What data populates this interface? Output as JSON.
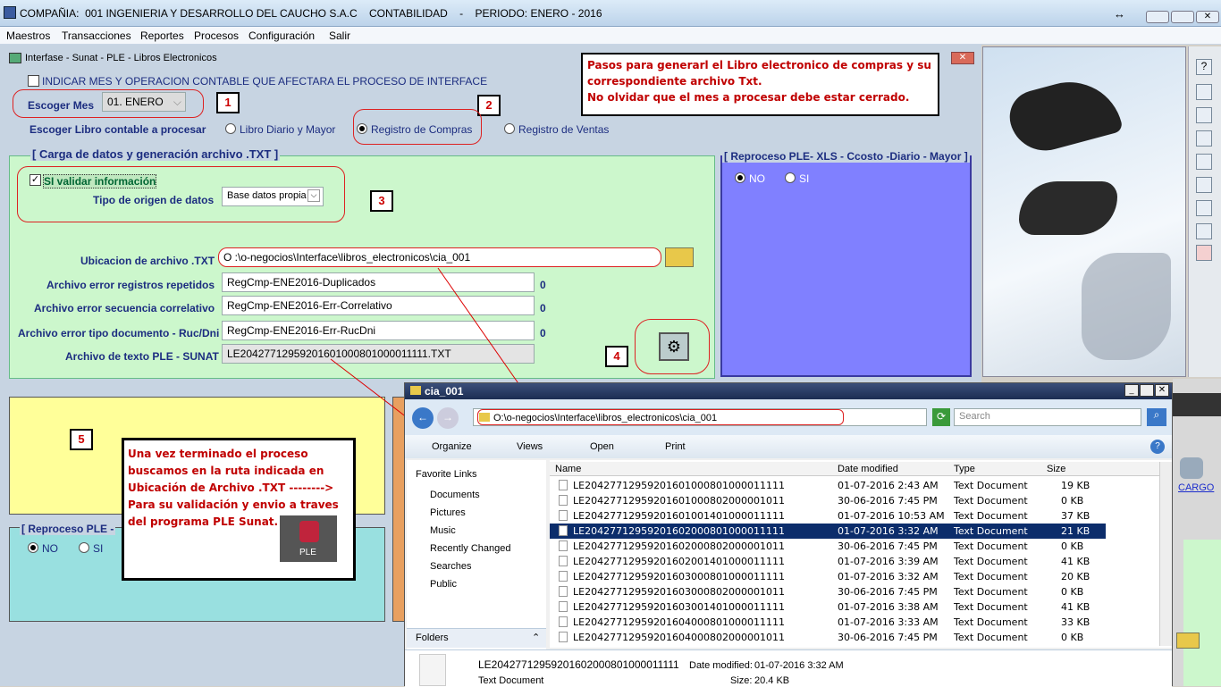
{
  "window": {
    "title": "COMPAÑIA:  001 INGENIERIA Y DESARROLLO DEL CAUCHO S.A.C    CONTABILIDAD    -    PERIODO: ENERO - 2016"
  },
  "menu": [
    "Maestros",
    "Transacciones",
    "Reportes",
    "Procesos",
    "Configuración",
    "Salir"
  ],
  "form": {
    "title": "Interfase - Sunat - PLE - Libros Electronicos",
    "indicator_label": "INDICAR MES Y OPERACION CONTABLE QUE AFECTARA EL PROCESO DE INTERFACE",
    "month_label": "Escoger Mes",
    "month_value": "01. ENERO",
    "book_label": "Escoger Libro contable a procesar",
    "books": [
      "Libro Diario y Mayor",
      "Registro de Compras",
      "Registro de Ventas"
    ],
    "carga_title": "[ Carga de datos y generación archivo  .TXT ]",
    "validate_label": "SI validar información",
    "origin_label": "Tipo de origen de datos",
    "origin_value": "Base datos propia",
    "location_label": "Ubicacion de archivo .TXT",
    "location_value": "O :\\o-negocios\\Interface\\libros_electronicos\\cia_001",
    "err_dup_label": "Archivo error registros repetidos",
    "err_dup_value": "RegCmp-ENE2016-Duplicados",
    "err_dup_count": "0",
    "err_seq_label": "Archivo error secuencia correlativo",
    "err_seq_value": "RegCmp-ENE2016-Err-Correlativo",
    "err_seq_count": "0",
    "err_ruc_label": "Archivo error tipo documento - Ruc/Dni",
    "err_ruc_value": "RegCmp-ENE2016-Err-RucDni",
    "err_ruc_count": "0",
    "txt_label": "Archivo de texto PLE - SUNAT",
    "txt_value": "LE20427712959201601000801000011111.TXT",
    "reproc_title": "[ Reproceso PLE- XLS - Ccosto -Diario - Mayor ]",
    "reproc_options": [
      "NO",
      "SI"
    ],
    "reproc2_title": "[ Reproceso PLE - ",
    "reproc2_options": [
      "NO",
      "SI"
    ],
    "steps": [
      "1",
      "2",
      "3",
      "4",
      "5"
    ]
  },
  "note_top": [
    "Pasos para generarl el Libro electronico de compras y su",
    "correspondiente archivo Txt.",
    "No olvidar que el mes a procesar debe estar cerrado."
  ],
  "note_bottom": [
    "Una vez terminado el proceso",
    "buscamos en la ruta indicada en",
    "Ubicación de Archivo .TXT        -------->",
    "Para su validación y envio a traves",
    "del programa PLE Sunat."
  ],
  "ple_logo": "PLE",
  "right_cargo": "CARGO",
  "explorer": {
    "title": "cia_001",
    "path": "O:\\o-negocios\\Interface\\libros_electronicos\\cia_001",
    "search_placeholder": "Search",
    "toolbar": [
      "Organize",
      "Views",
      "Open",
      "Print"
    ],
    "fav_title": "Favorite Links",
    "favorites": [
      "Documents",
      "Pictures",
      "Music",
      "Recently Changed",
      "Searches",
      "Public"
    ],
    "folders_label": "Folders",
    "columns": [
      "Name",
      "Date modified",
      "Type",
      "Size"
    ],
    "files": [
      {
        "name": "LE20427712959201601000801000011111",
        "date": "01-07-2016 2:43 AM",
        "type": "Text Document",
        "size": "19 KB"
      },
      {
        "name": "LE20427712959201601000802000001011",
        "date": "30-06-2016 7:45 PM",
        "type": "Text Document",
        "size": "0 KB"
      },
      {
        "name": "LE20427712959201601001401000011111",
        "date": "01-07-2016 10:53 AM",
        "type": "Text Document",
        "size": "37 KB"
      },
      {
        "name": "LE20427712959201602000801000011111",
        "date": "01-07-2016 3:32 AM",
        "type": "Text Document",
        "size": "21 KB"
      },
      {
        "name": "LE20427712959201602000802000001011",
        "date": "30-06-2016 7:45 PM",
        "type": "Text Document",
        "size": "0 KB"
      },
      {
        "name": "LE20427712959201602001401000011111",
        "date": "01-07-2016 3:39 AM",
        "type": "Text Document",
        "size": "41 KB"
      },
      {
        "name": "LE20427712959201603000801000011111",
        "date": "01-07-2016 3:32 AM",
        "type": "Text Document",
        "size": "20 KB"
      },
      {
        "name": "LE20427712959201603000802000001011",
        "date": "30-06-2016 7:45 PM",
        "type": "Text Document",
        "size": "0 KB"
      },
      {
        "name": "LE20427712959201603001401000011111",
        "date": "01-07-2016 3:38 AM",
        "type": "Text Document",
        "size": "41 KB"
      },
      {
        "name": "LE20427712959201604000801000011111",
        "date": "01-07-2016 3:33 AM",
        "type": "Text Document",
        "size": "33 KB"
      },
      {
        "name": "LE20427712959201604000802000001011",
        "date": "30-06-2016 7:45 PM",
        "type": "Text Document",
        "size": "0 KB"
      }
    ],
    "details": {
      "name": "LE20427712959201602000801000011111",
      "date_label": "Date modified:",
      "date": "01-07-2016 3:32 AM",
      "type": "Text Document",
      "size_label": "Size:",
      "size": "20.4 KB"
    }
  }
}
